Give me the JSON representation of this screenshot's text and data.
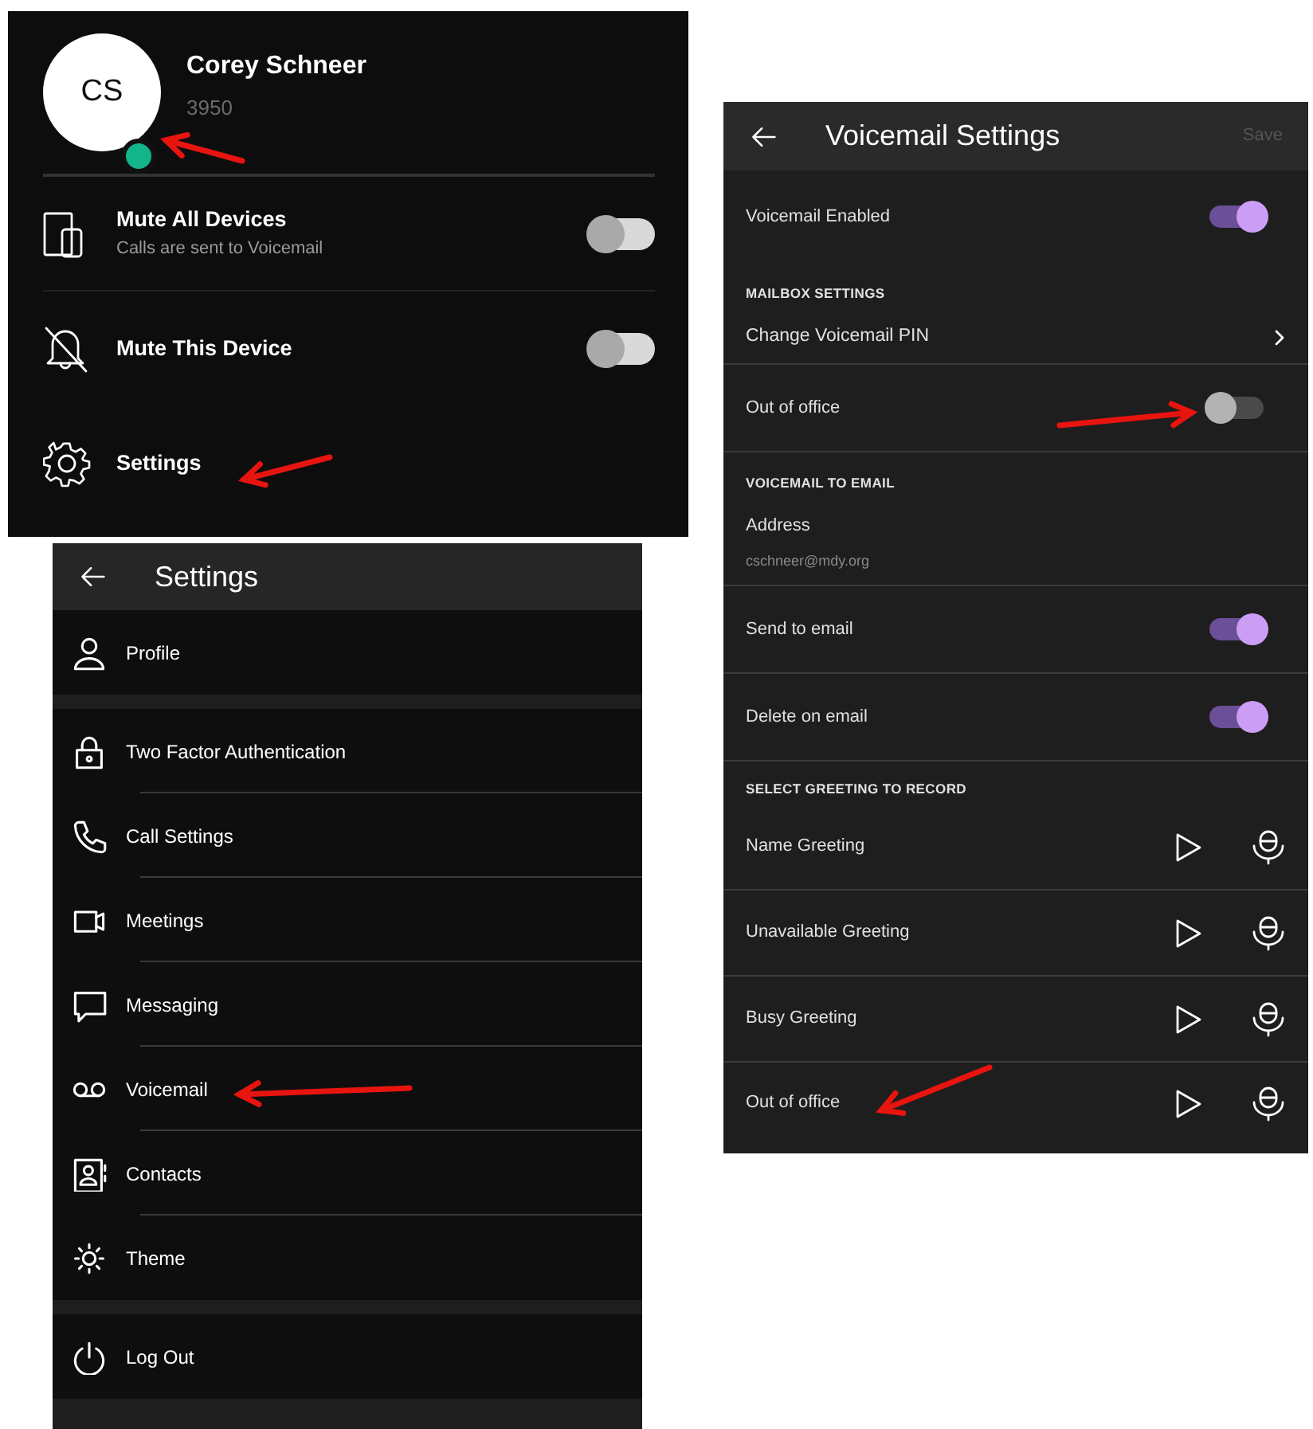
{
  "profile_menu": {
    "avatar_initials": "CS",
    "name": "Corey Schneer",
    "extension": "3950",
    "items": [
      {
        "kind": "toggle",
        "label": "Mute All Devices",
        "sublabel": "Calls are sent to Voicemail",
        "on": false
      },
      {
        "kind": "toggle",
        "label": "Mute This Device",
        "on": false
      },
      {
        "kind": "link",
        "label": "Settings"
      }
    ]
  },
  "settings_screen": {
    "title": "Settings",
    "groups": [
      {
        "items": [
          "Profile"
        ]
      },
      {
        "items": [
          "Two Factor Authentication",
          "Call Settings",
          "Meetings",
          "Messaging",
          "Voicemail",
          "Contacts",
          "Theme"
        ]
      },
      {
        "items": [
          "Log Out"
        ]
      }
    ]
  },
  "voicemail_screen": {
    "title": "Voicemail Settings",
    "save_button": {
      "label": "Save",
      "disabled": true
    },
    "rows": [
      {
        "kind": "toggle",
        "label": "Voicemail Enabled",
        "on": true
      },
      {
        "kind": "header",
        "label": "MAILBOX SETTINGS"
      },
      {
        "kind": "link",
        "label": "Change Voicemail PIN"
      },
      {
        "kind": "toggle",
        "label": "Out of office",
        "on": false
      },
      {
        "kind": "header",
        "label": "VOICEMAIL TO EMAIL"
      },
      {
        "kind": "field",
        "label": "Address",
        "value": "cschneer@mdy.org"
      },
      {
        "kind": "toggle",
        "label": "Send to email",
        "on": true
      },
      {
        "kind": "toggle",
        "label": "Delete on email",
        "on": true
      },
      {
        "kind": "header",
        "label": "SELECT GREETING TO RECORD"
      },
      {
        "kind": "greeting",
        "label": "Name Greeting"
      },
      {
        "kind": "greeting",
        "label": "Unavailable Greeting"
      },
      {
        "kind": "greeting",
        "label": "Busy Greeting"
      },
      {
        "kind": "greeting",
        "label": "Out of office"
      }
    ]
  }
}
